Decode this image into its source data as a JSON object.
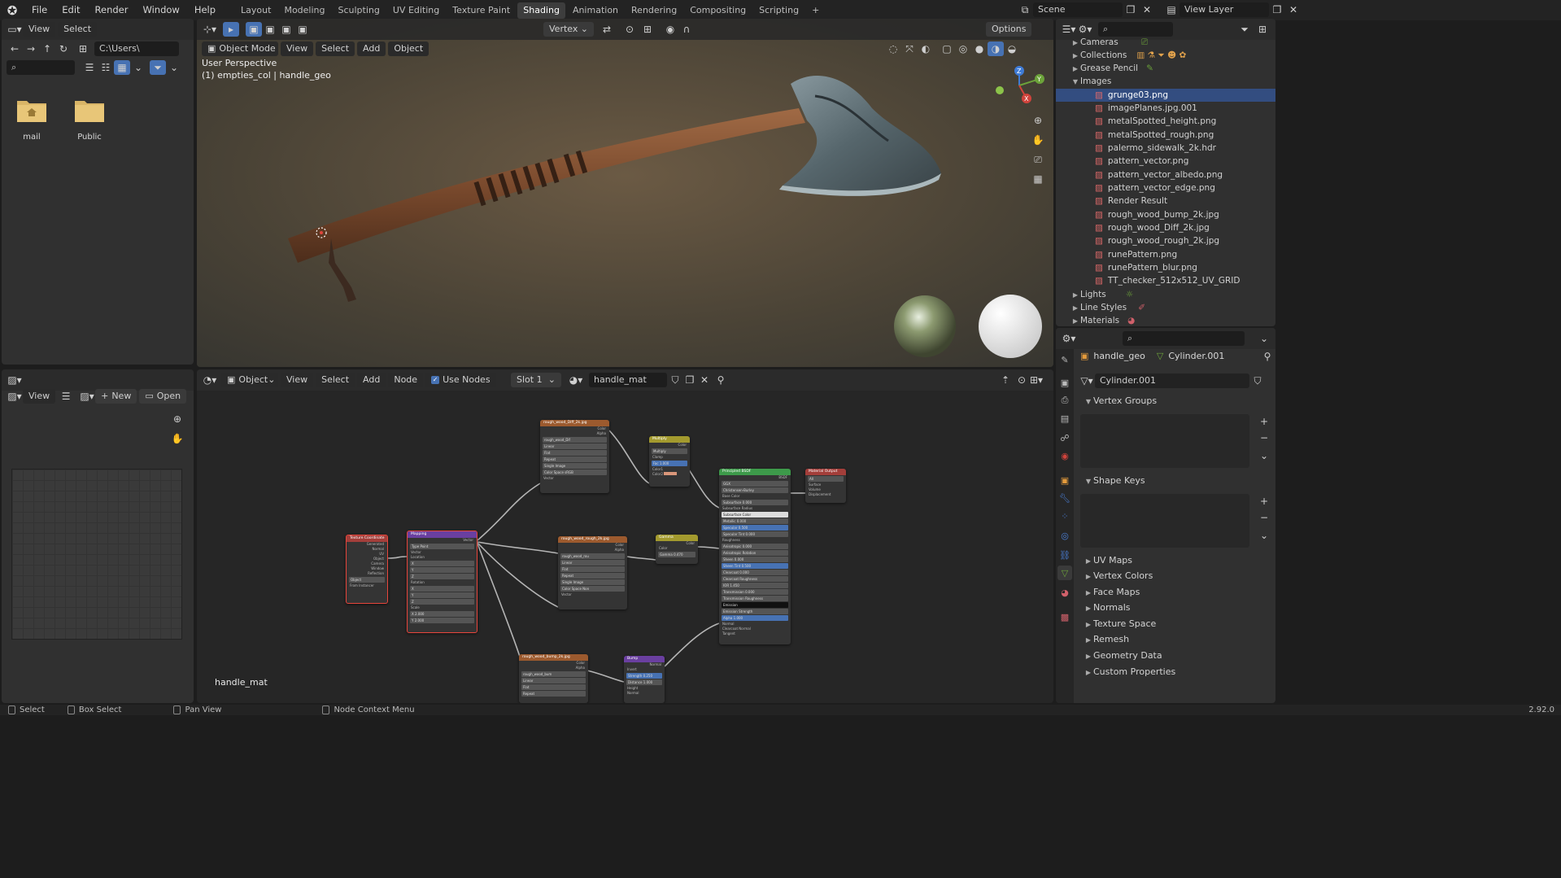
{
  "menus": [
    "File",
    "Edit",
    "Render",
    "Window",
    "Help"
  ],
  "workspaces": [
    "Layout",
    "Modeling",
    "Sculpting",
    "UV Editing",
    "Texture Paint",
    "Shading",
    "Animation",
    "Rendering",
    "Compositing",
    "Scripting"
  ],
  "active_workspace": "Shading",
  "scene": "Scene",
  "view_layer": "View Layer",
  "filebrowser": {
    "menu": [
      "View",
      "Select"
    ],
    "path": "C:\\Users\\",
    "folders": [
      "mail",
      "Public"
    ]
  },
  "viewport": {
    "mode": "Object Mode",
    "menus": [
      "View",
      "Select",
      "Add",
      "Object"
    ],
    "pivot": "Vertex",
    "options": "Options",
    "perspective": "User Perspective",
    "context": "(1) empties_col | handle_geo"
  },
  "outliner": {
    "top": [
      "Cameras",
      "Collections",
      "Grease Pencil"
    ],
    "images_label": "Images",
    "images": [
      "grunge03.png",
      "imagePlanes.jpg.001",
      "metalSpotted_height.png",
      "metalSpotted_rough.png",
      "palermo_sidewalk_2k.hdr",
      "pattern_vector.png",
      "pattern_vector_albedo.png",
      "pattern_vector_edge.png",
      "Render Result",
      "rough_wood_bump_2k.jpg",
      "rough_wood_Diff_2k.jpg",
      "rough_wood_rough_2k.jpg",
      "runePattern.png",
      "runePattern_blur.png",
      "TT_checker_512x512_UV_GRID"
    ],
    "selected": "grunge03.png",
    "bottom": [
      "Lights",
      "Line Styles",
      "Materials"
    ]
  },
  "image_editor": {
    "view": "View",
    "new": "New",
    "open": "Open"
  },
  "node_editor": {
    "mode": "Object",
    "menus": [
      "View",
      "Select",
      "Add",
      "Node"
    ],
    "use_nodes": "Use Nodes",
    "slot": "Slot 1",
    "material": "handle_mat",
    "label": "handle_mat"
  },
  "properties": {
    "object": "handle_geo",
    "mesh": "Cylinder.001",
    "data_name": "Cylinder.001",
    "sections_open": [
      "Vertex Groups",
      "Shape Keys"
    ],
    "sections": [
      "UV Maps",
      "Vertex Colors",
      "Face Maps",
      "Normals",
      "Texture Space",
      "Remesh",
      "Geometry Data",
      "Custom Properties"
    ]
  },
  "status": {
    "items": [
      "Select",
      "Box Select",
      "Pan View",
      "Node Context Menu"
    ],
    "version": "2.92.0"
  },
  "nodes": {
    "tex_coord": "Texture Coordinate",
    "mapping": "Mapping",
    "diff": "rough_wood_Diff_2k.jpg",
    "rough": "rough_wood_rough_2k.jpg",
    "bump_tex": "rough_wood_bump_2k.jpg",
    "multiply": "Multiply",
    "gamma": "Gamma",
    "bump": "Bump",
    "bsdf": "Principled BSDF",
    "output": "Material Output"
  },
  "colors": {
    "accent": "#4772b3",
    "selected_row": "#334d80",
    "header": "#2b2b2b"
  }
}
